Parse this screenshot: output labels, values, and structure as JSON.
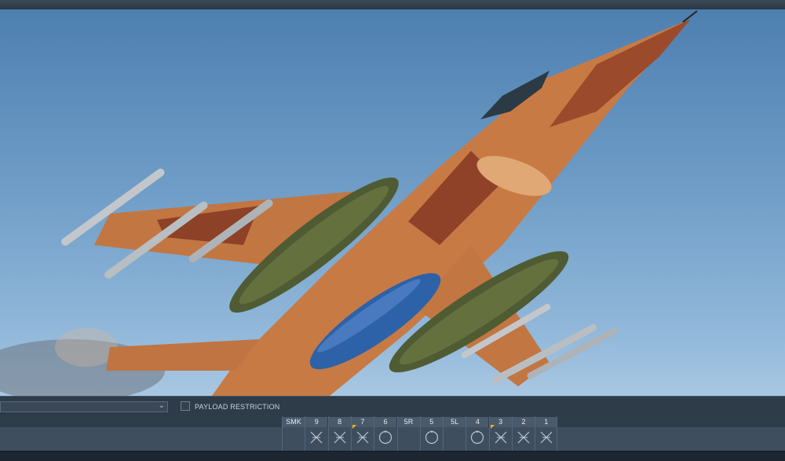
{
  "window": {
    "accent_color": "#4a5a6b"
  },
  "preview": {
    "aircraft_livery": "aggressor desert camo",
    "stores": [
      "wingtip missiles",
      "underwing missiles",
      "digital camo pods",
      "blue fuel tank"
    ]
  },
  "controls": {
    "loadout_dropdown_value": "",
    "payload_restriction_label": "PAYLOAD RESTRICTION",
    "payload_restriction_checked": false
  },
  "pylons": [
    {
      "label": "SMK",
      "icon": "empty",
      "flag": false
    },
    {
      "label": "9",
      "icon": "missile-x-icon",
      "flag": false
    },
    {
      "label": "8",
      "icon": "missile-x-icon",
      "flag": false
    },
    {
      "label": "7",
      "icon": "missile-x-icon",
      "flag": true
    },
    {
      "label": "6",
      "icon": "tank-circle-icon",
      "flag": false
    },
    {
      "label": "5R",
      "icon": "empty",
      "flag": false
    },
    {
      "label": "5",
      "icon": "tank-circle-icon",
      "flag": false
    },
    {
      "label": "5L",
      "icon": "empty",
      "flag": false
    },
    {
      "label": "4",
      "icon": "tank-circle-icon",
      "flag": false
    },
    {
      "label": "3",
      "icon": "missile-x-icon",
      "flag": true
    },
    {
      "label": "2",
      "icon": "missile-x-icon",
      "flag": false
    },
    {
      "label": "1",
      "icon": "missile-x-icon",
      "flag": false
    }
  ]
}
